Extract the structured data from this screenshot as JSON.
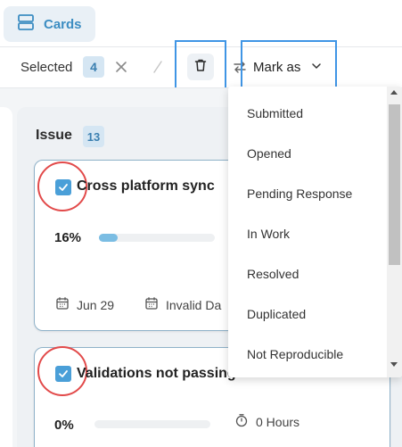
{
  "topbar": {
    "cards_label": "Cards",
    "cards_icon": "cards-view-icon"
  },
  "selection_bar": {
    "selected_label": "Selected",
    "selected_count": "4",
    "clear_icon": "close-icon",
    "delete_icon": "trash-icon",
    "swap_icon": "swap-arrows-icon",
    "mark_as_label": "Mark as",
    "mark_as_icon": "chevron-down-icon"
  },
  "column": {
    "title": "Issue",
    "count": "13"
  },
  "cards": [
    {
      "title": "Cross platform sync",
      "checked": true,
      "progress_label": "16%",
      "progress": 0.16,
      "start_date": "Jun 29",
      "end_date": "Invalid Da"
    },
    {
      "title": "Validations not passing",
      "checked": true,
      "progress_label": "0%",
      "progress": 0,
      "hours": "0 Hours"
    }
  ],
  "mark_as_menu": {
    "options": [
      "Submitted",
      "Opened",
      "Pending Response",
      "In Work",
      "Resolved",
      "Duplicated",
      "Not Reproducible"
    ]
  },
  "colors": {
    "accent": "#3c8dc2",
    "checkbox": "#4a9fd8",
    "highlight_box": "#3f95e5",
    "annotation_ring": "#e24a4a",
    "progress_fill": "#7bbde3"
  }
}
